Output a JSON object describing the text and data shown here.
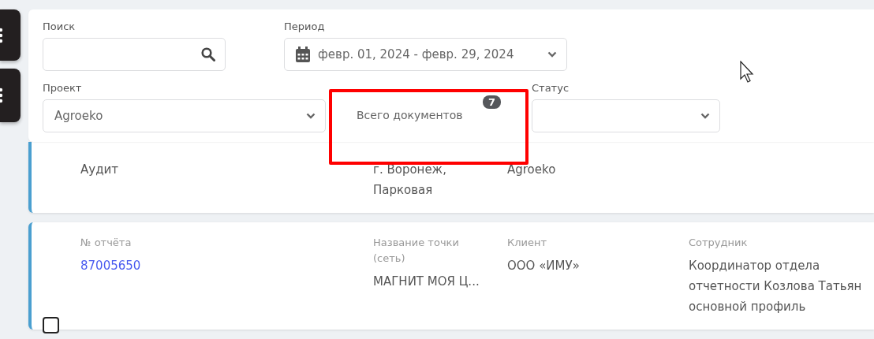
{
  "filters": {
    "search": {
      "label": "Поиск"
    },
    "period": {
      "label": "Период",
      "value": "февр. 01, 2024 - февр. 29, 2024"
    },
    "project": {
      "label": "Проект",
      "value": "Agroeko"
    },
    "total": {
      "label": "Всего документов",
      "count": "7"
    },
    "status": {
      "label": "Статус"
    }
  },
  "records": [
    {
      "fields": [
        {
          "kind": "text",
          "lines": [
            "Аудит"
          ]
        },
        {
          "kind": "text",
          "lines": [
            "г. Воронеж,",
            "Парковая"
          ]
        },
        {
          "kind": "text",
          "lines": [
            "Agroeko"
          ]
        }
      ]
    },
    {
      "checked": false,
      "fields": [
        {
          "kind": "link",
          "label": "№ отчёта",
          "lines": [
            "87005650"
          ]
        },
        {
          "kind": "text",
          "label": "Название точки (сеть)",
          "lines": [
            "МАГНИТ МОЯ Ц..."
          ]
        },
        {
          "kind": "text",
          "label": "Клиент",
          "lines": [
            "ООО «ИМУ»"
          ]
        },
        {
          "kind": "text",
          "label": "Сотрудник",
          "lines": [
            "Координатор отдела",
            "отчетности Козлова Татьян",
            "основной профиль"
          ]
        }
      ]
    }
  ]
}
